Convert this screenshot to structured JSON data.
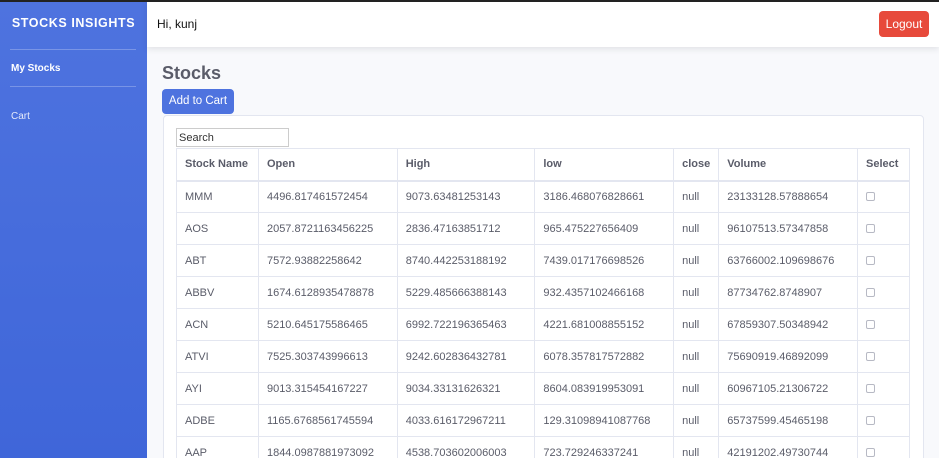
{
  "sidebar": {
    "brand": "STOCKS INSIGHTS",
    "items": [
      {
        "label": "My Stocks"
      },
      {
        "label": "Cart"
      }
    ]
  },
  "topbar": {
    "greeting": "Hi, kunj",
    "logout_label": "Logout"
  },
  "main": {
    "title": "Stocks",
    "add_to_cart_label": "Add to Cart",
    "search_placeholder": "Search",
    "columns": [
      "Stock Name",
      "Open",
      "High",
      "low",
      "close",
      "Volume",
      "Select"
    ],
    "rows": [
      {
        "name": "MMM",
        "open": "4496.817461572454",
        "high": "9073.63481253143",
        "low": "3186.468076828661",
        "close": "null",
        "volume": "23133128.57888654",
        "selected": false
      },
      {
        "name": "AOS",
        "open": "2057.8721163456225",
        "high": "2836.47163851712",
        "low": "965.475227656409",
        "close": "null",
        "volume": "96107513.57347858",
        "selected": false
      },
      {
        "name": "ABT",
        "open": "7572.93882258642",
        "high": "8740.442253188192",
        "low": "7439.017176698526",
        "close": "null",
        "volume": "63766002.109698676",
        "selected": false
      },
      {
        "name": "ABBV",
        "open": "1674.6128935478878",
        "high": "5229.485666388143",
        "low": "932.4357102466168",
        "close": "null",
        "volume": "87734762.8748907",
        "selected": false
      },
      {
        "name": "ACN",
        "open": "5210.645175586465",
        "high": "6992.722196365463",
        "low": "4221.681008855152",
        "close": "null",
        "volume": "67859307.50348942",
        "selected": false
      },
      {
        "name": "ATVI",
        "open": "7525.303743996613",
        "high": "9242.602836432781",
        "low": "6078.357817572882",
        "close": "null",
        "volume": "75690919.46892099",
        "selected": false
      },
      {
        "name": "AYI",
        "open": "9013.315454167227",
        "high": "9034.33131626321",
        "low": "8604.083919953091",
        "close": "null",
        "volume": "60967105.21306722",
        "selected": false
      },
      {
        "name": "ADBE",
        "open": "1165.6768561745594",
        "high": "4033.616172967211",
        "low": "129.31098941087768",
        "close": "null",
        "volume": "65737599.45465198",
        "selected": false
      },
      {
        "name": "AAP",
        "open": "1844.0987881973092",
        "high": "4538.703602006003",
        "low": "723.729246337241",
        "close": "null",
        "volume": "42191202.49730744",
        "selected": false
      }
    ]
  },
  "colors": {
    "sidebar": "#4e73df",
    "primary_button": "#4e73df",
    "danger_button": "#e74a3b"
  }
}
